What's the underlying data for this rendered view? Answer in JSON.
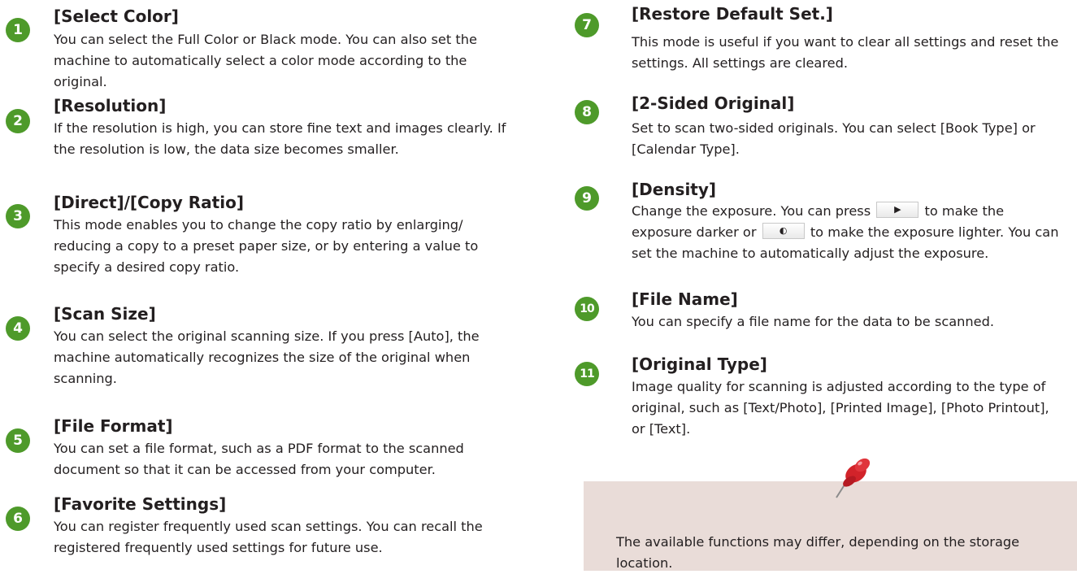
{
  "items": [
    {
      "number": "1",
      "title": "[Select Color]",
      "description": "You can select the Full Color or Black mode. You can also set the machine to automatically select a color mode according to the original."
    },
    {
      "number": "2",
      "title": "[Resolution]",
      "description": "If the resolution is high, you can store fine text and images clearly. If the resolution is low, the data size becomes smaller."
    },
    {
      "number": "3",
      "title": "[Direct]/[Copy Ratio]",
      "description": "This mode enables you to change the copy ratio by enlarging/ reducing a copy to a preset paper size, or by entering a value to specify a desired copy ratio."
    },
    {
      "number": "4",
      "title": "[Scan Size]",
      "description": "You can select the original scanning size. If you press [Auto], the machine automatically recognizes the size of the original when scanning."
    },
    {
      "number": "5",
      "title": "[File Format]",
      "description": "You can set a file format, such as a PDF format to the scanned document so that it can be accessed from your computer."
    },
    {
      "number": "6",
      "title": "[Favorite Settings]",
      "description": "You can register frequently used scan settings. You can recall the registered frequently used settings for future use."
    },
    {
      "number": "7",
      "title": "[Restore Default Set.]",
      "description": "This mode is useful if you want to clear all settings and reset the settings. All settings are cleared."
    },
    {
      "number": "8",
      "title": "[2-Sided Original]",
      "description": "Set to scan two-sided originals. You can select [Book Type] or [Calendar Type]."
    },
    {
      "number": "9",
      "title": "[Density]",
      "description_parts": [
        "Change the exposure. You can press",
        "to make the exposure darker or",
        "to make the exposure lighter. You can set the machine to automatically adjust the exposure."
      ]
    },
    {
      "number": "10",
      "title": "[File Name]",
      "description": "You can specify a file name for the data to be scanned."
    },
    {
      "number": "11",
      "title": "[Original Type]",
      "description": "Image quality for scanning is adjusted according to the type of original, such as [Text/Photo], [Printed Image], [Photo Printout], or [Text]."
    }
  ],
  "note": {
    "text": "The available functions may differ, depending on the storage location."
  },
  "colors": {
    "badge": "#4e9a2a",
    "note_background": "#e9dcd8",
    "pin": "#d2232a"
  },
  "icons": {
    "darker_key": "darker-key-icon",
    "lighter_key": "lighter-key-icon",
    "note": "pushpin-icon"
  }
}
